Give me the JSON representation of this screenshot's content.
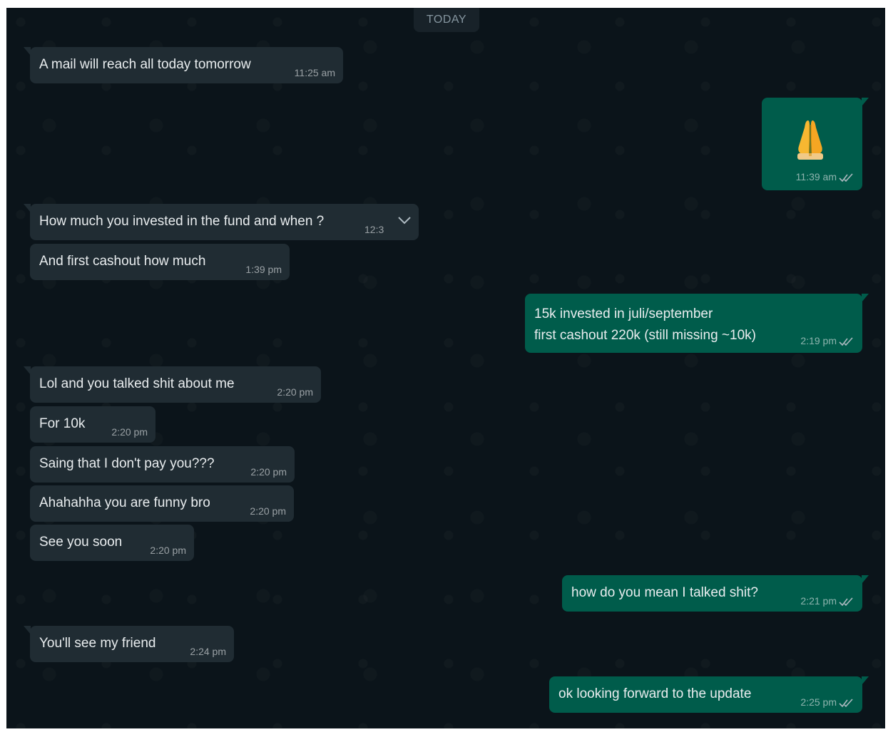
{
  "chat": {
    "date_label": "TODAY",
    "messages": [
      {
        "text": "A mail will reach all today tomorrow",
        "time": "11:25 am"
      },
      {
        "emoji": "folded-hands",
        "time": "11:39 am"
      },
      {
        "text": "How much you invested in the fund and when ?",
        "time": "12:3"
      },
      {
        "text": "And first cashout how much",
        "time": "1:39 pm"
      },
      {
        "lines": [
          "15k invested in juli/september",
          "first cashout 220k (still missing ~10k)"
        ],
        "time": "2:19 pm"
      },
      {
        "text": "Lol and you talked shit about me",
        "time": "2:20 pm"
      },
      {
        "text": "For 10k",
        "time": "2:20 pm"
      },
      {
        "text": "Saing that I don't pay you???",
        "time": "2:20 pm"
      },
      {
        "text": "Ahahahha you are funny bro",
        "time": "2:20 pm"
      },
      {
        "text": "See you soon",
        "time": "2:20 pm"
      },
      {
        "text": "how do you mean I talked shit?",
        "time": "2:21 pm"
      },
      {
        "text": "You'll see my friend",
        "time": "2:24 pm"
      },
      {
        "text": "ok looking forward to the update",
        "time": "2:25 pm"
      }
    ]
  },
  "colors": {
    "background": "#0b141a",
    "incoming_bubble": "#202c33",
    "outgoing_bubble": "#005c4b",
    "text": "#e9edef",
    "meta_text": "#8696a0"
  },
  "icons": {
    "read_receipt": "double-check-icon",
    "message_menu": "chevron-down-icon",
    "emoji": "folded-hands-emoji"
  }
}
